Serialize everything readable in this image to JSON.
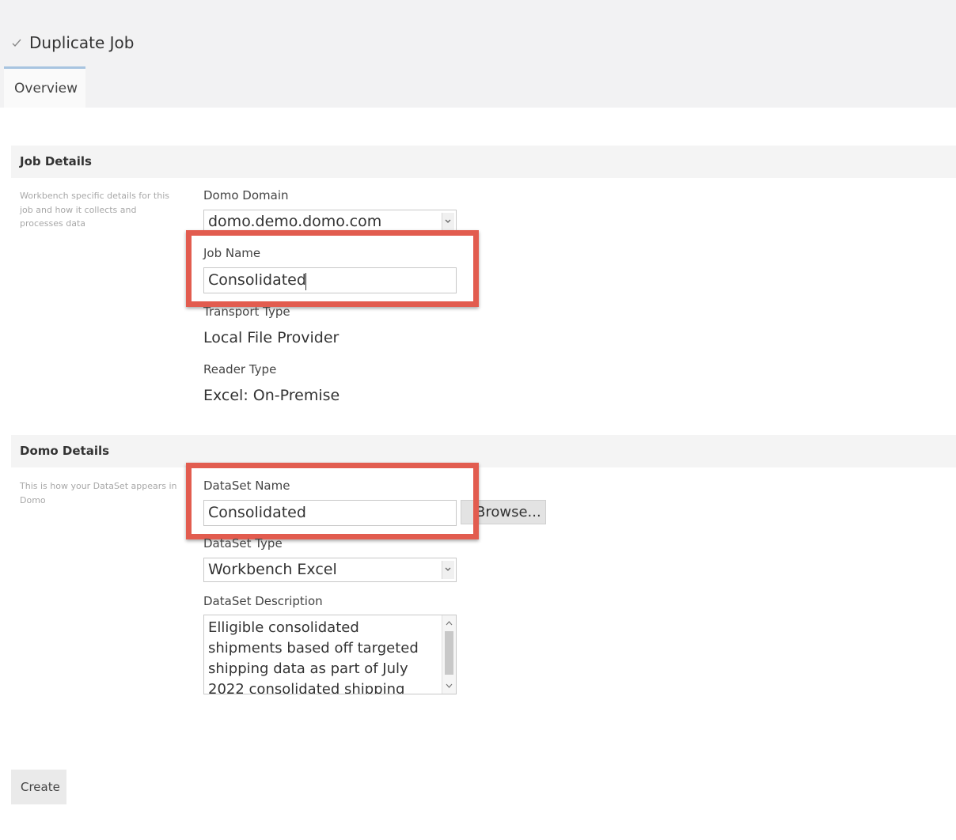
{
  "header": {
    "title": "Duplicate Job",
    "tabs": [
      {
        "label": "Overview",
        "active": true
      }
    ]
  },
  "job_details": {
    "section_title": "Job Details",
    "description": "Workbench specific details for this job and how it collects and processes data",
    "domo_domain": {
      "label": "Domo Domain",
      "value": "domo.demo.domo.com"
    },
    "job_name": {
      "label": "Job Name",
      "value": "Consolidated"
    },
    "transport_type": {
      "label": "Transport Type",
      "value": "Local File Provider"
    },
    "reader_type": {
      "label": "Reader Type",
      "value": "Excel: On-Premise"
    }
  },
  "domo_details": {
    "section_title": "Domo Details",
    "description": "This is how your DataSet appears in Domo",
    "dataset_name": {
      "label": "DataSet Name",
      "value": "Consolidated",
      "browse_label": "Browse..."
    },
    "dataset_type": {
      "label": "DataSet Type",
      "value": "Workbench Excel"
    },
    "dataset_description": {
      "label": "DataSet Description",
      "value": "Elligible consolidated shipments based off targeted shipping data as part of July 2022 consolidated shipping plan POC."
    }
  },
  "actions": {
    "create_label": "Create"
  },
  "colors": {
    "highlight": "#e25c4f",
    "header_bg": "#f2f2f3",
    "section_bg": "#f4f4f4"
  },
  "icons": {
    "collapse": "check-icon",
    "dropdown": "chevron-down-icon"
  }
}
